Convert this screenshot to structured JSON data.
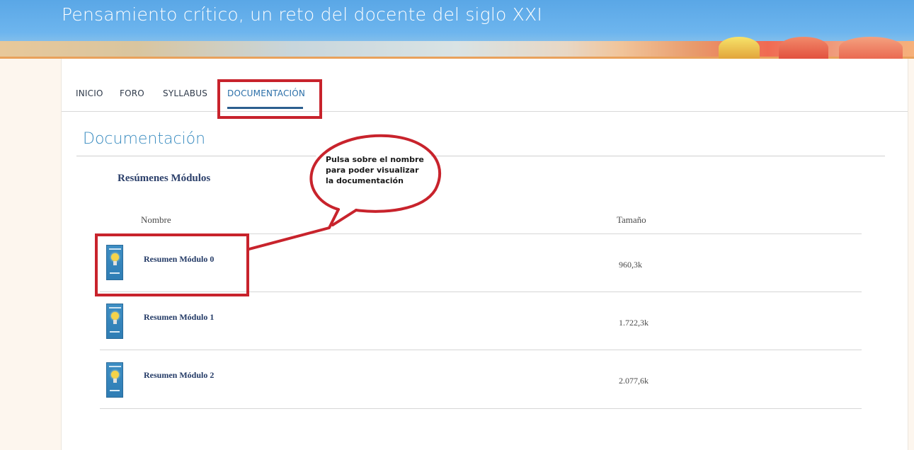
{
  "banner": {
    "title": "Pensamiento crítico, un reto del docente del siglo XXI"
  },
  "nav": {
    "items": [
      {
        "label": "INICIO"
      },
      {
        "label": "FORO"
      },
      {
        "label": "SYLLABUS"
      },
      {
        "label": "DOCUMENTACIÓN",
        "active": true
      }
    ]
  },
  "page": {
    "title": "Documentación",
    "section_heading": "Resúmenes Módulos"
  },
  "table": {
    "columns": {
      "name": "Nombre",
      "size": "Tamaño"
    },
    "rows": [
      {
        "name": "Resumen Módulo 0",
        "size": "960,3k",
        "thumbnail": "lightbulb-icon"
      },
      {
        "name": "Resumen Módulo 1",
        "size": "1.722,3k",
        "thumbnail": "lightbulb-icon"
      },
      {
        "name": "Resumen Módulo 2",
        "size": "2.077,6k",
        "thumbnail": "lightbulb-icon"
      }
    ]
  },
  "annotation": {
    "callout_lines": [
      "Pulsa sobre el nombre",
      "para poder visualizar",
      "la documentación"
    ],
    "highlight_color": "#c8232c"
  },
  "colors": {
    "banner": "#5aa7e6",
    "accent": "#3a8cc0",
    "nav_active": "#2b6fa8",
    "link": "#233a66"
  }
}
